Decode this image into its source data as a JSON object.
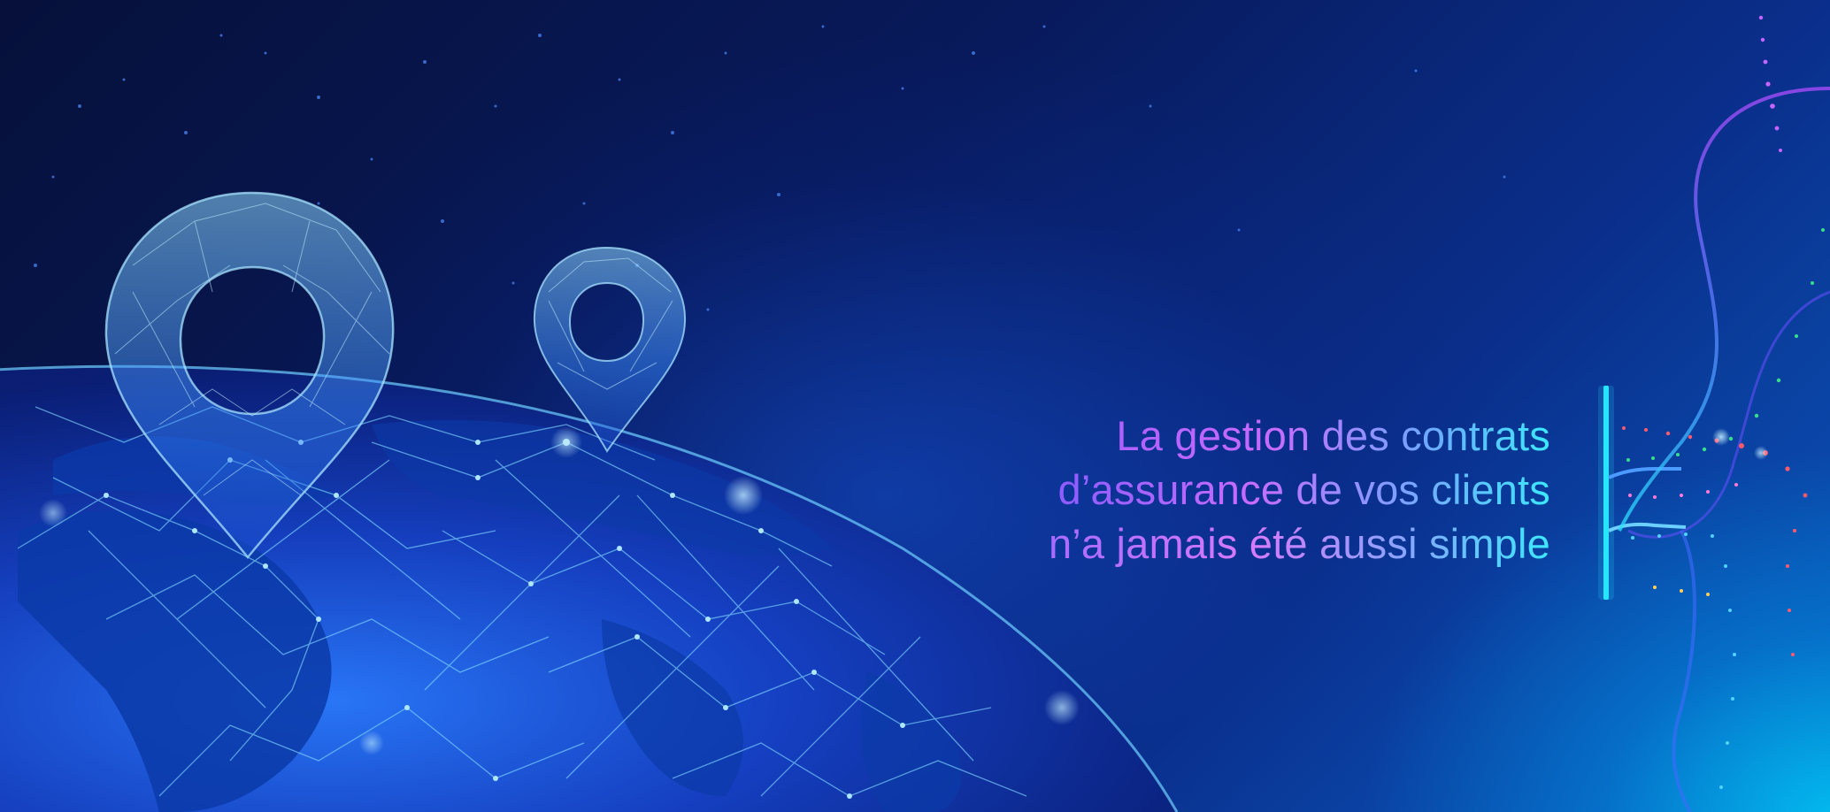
{
  "hero": {
    "tagline_lines": [
      "La gestion des contrats",
      "d’assurance de vos clients",
      "n’a jamais été aussi simple"
    ]
  },
  "illustration": {
    "subject": "globe-with-location-pins",
    "pin_icon": "map-pin-icon",
    "colors": {
      "background_dark": "#050d3a",
      "globe_blue": "#1e5cff",
      "network_line": "#6fd8ff",
      "text_purple": "#a45cff",
      "text_cyan": "#3ce8ff",
      "accent_bar": "#28e6ff"
    }
  }
}
